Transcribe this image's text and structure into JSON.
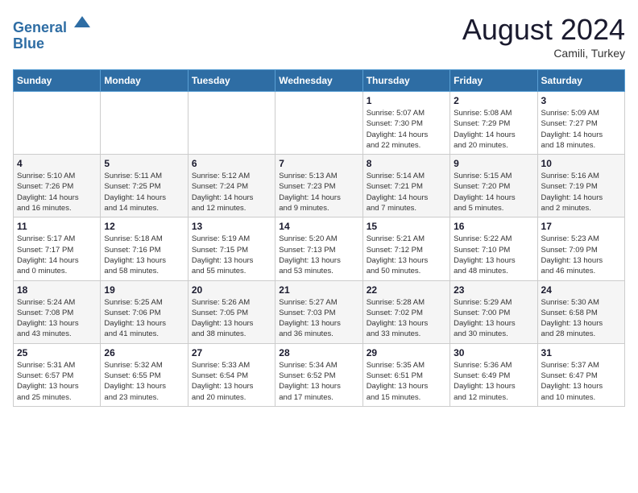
{
  "header": {
    "logo_line1": "General",
    "logo_line2": "Blue",
    "month_year": "August 2024",
    "location": "Camili, Turkey"
  },
  "weekdays": [
    "Sunday",
    "Monday",
    "Tuesday",
    "Wednesday",
    "Thursday",
    "Friday",
    "Saturday"
  ],
  "weeks": [
    [
      {
        "day": "",
        "info": ""
      },
      {
        "day": "",
        "info": ""
      },
      {
        "day": "",
        "info": ""
      },
      {
        "day": "",
        "info": ""
      },
      {
        "day": "1",
        "info": "Sunrise: 5:07 AM\nSunset: 7:30 PM\nDaylight: 14 hours\nand 22 minutes."
      },
      {
        "day": "2",
        "info": "Sunrise: 5:08 AM\nSunset: 7:29 PM\nDaylight: 14 hours\nand 20 minutes."
      },
      {
        "day": "3",
        "info": "Sunrise: 5:09 AM\nSunset: 7:27 PM\nDaylight: 14 hours\nand 18 minutes."
      }
    ],
    [
      {
        "day": "4",
        "info": "Sunrise: 5:10 AM\nSunset: 7:26 PM\nDaylight: 14 hours\nand 16 minutes."
      },
      {
        "day": "5",
        "info": "Sunrise: 5:11 AM\nSunset: 7:25 PM\nDaylight: 14 hours\nand 14 minutes."
      },
      {
        "day": "6",
        "info": "Sunrise: 5:12 AM\nSunset: 7:24 PM\nDaylight: 14 hours\nand 12 minutes."
      },
      {
        "day": "7",
        "info": "Sunrise: 5:13 AM\nSunset: 7:23 PM\nDaylight: 14 hours\nand 9 minutes."
      },
      {
        "day": "8",
        "info": "Sunrise: 5:14 AM\nSunset: 7:21 PM\nDaylight: 14 hours\nand 7 minutes."
      },
      {
        "day": "9",
        "info": "Sunrise: 5:15 AM\nSunset: 7:20 PM\nDaylight: 14 hours\nand 5 minutes."
      },
      {
        "day": "10",
        "info": "Sunrise: 5:16 AM\nSunset: 7:19 PM\nDaylight: 14 hours\nand 2 minutes."
      }
    ],
    [
      {
        "day": "11",
        "info": "Sunrise: 5:17 AM\nSunset: 7:17 PM\nDaylight: 14 hours\nand 0 minutes."
      },
      {
        "day": "12",
        "info": "Sunrise: 5:18 AM\nSunset: 7:16 PM\nDaylight: 13 hours\nand 58 minutes."
      },
      {
        "day": "13",
        "info": "Sunrise: 5:19 AM\nSunset: 7:15 PM\nDaylight: 13 hours\nand 55 minutes."
      },
      {
        "day": "14",
        "info": "Sunrise: 5:20 AM\nSunset: 7:13 PM\nDaylight: 13 hours\nand 53 minutes."
      },
      {
        "day": "15",
        "info": "Sunrise: 5:21 AM\nSunset: 7:12 PM\nDaylight: 13 hours\nand 50 minutes."
      },
      {
        "day": "16",
        "info": "Sunrise: 5:22 AM\nSunset: 7:10 PM\nDaylight: 13 hours\nand 48 minutes."
      },
      {
        "day": "17",
        "info": "Sunrise: 5:23 AM\nSunset: 7:09 PM\nDaylight: 13 hours\nand 46 minutes."
      }
    ],
    [
      {
        "day": "18",
        "info": "Sunrise: 5:24 AM\nSunset: 7:08 PM\nDaylight: 13 hours\nand 43 minutes."
      },
      {
        "day": "19",
        "info": "Sunrise: 5:25 AM\nSunset: 7:06 PM\nDaylight: 13 hours\nand 41 minutes."
      },
      {
        "day": "20",
        "info": "Sunrise: 5:26 AM\nSunset: 7:05 PM\nDaylight: 13 hours\nand 38 minutes."
      },
      {
        "day": "21",
        "info": "Sunrise: 5:27 AM\nSunset: 7:03 PM\nDaylight: 13 hours\nand 36 minutes."
      },
      {
        "day": "22",
        "info": "Sunrise: 5:28 AM\nSunset: 7:02 PM\nDaylight: 13 hours\nand 33 minutes."
      },
      {
        "day": "23",
        "info": "Sunrise: 5:29 AM\nSunset: 7:00 PM\nDaylight: 13 hours\nand 30 minutes."
      },
      {
        "day": "24",
        "info": "Sunrise: 5:30 AM\nSunset: 6:58 PM\nDaylight: 13 hours\nand 28 minutes."
      }
    ],
    [
      {
        "day": "25",
        "info": "Sunrise: 5:31 AM\nSunset: 6:57 PM\nDaylight: 13 hours\nand 25 minutes."
      },
      {
        "day": "26",
        "info": "Sunrise: 5:32 AM\nSunset: 6:55 PM\nDaylight: 13 hours\nand 23 minutes."
      },
      {
        "day": "27",
        "info": "Sunrise: 5:33 AM\nSunset: 6:54 PM\nDaylight: 13 hours\nand 20 minutes."
      },
      {
        "day": "28",
        "info": "Sunrise: 5:34 AM\nSunset: 6:52 PM\nDaylight: 13 hours\nand 17 minutes."
      },
      {
        "day": "29",
        "info": "Sunrise: 5:35 AM\nSunset: 6:51 PM\nDaylight: 13 hours\nand 15 minutes."
      },
      {
        "day": "30",
        "info": "Sunrise: 5:36 AM\nSunset: 6:49 PM\nDaylight: 13 hours\nand 12 minutes."
      },
      {
        "day": "31",
        "info": "Sunrise: 5:37 AM\nSunset: 6:47 PM\nDaylight: 13 hours\nand 10 minutes."
      }
    ]
  ]
}
